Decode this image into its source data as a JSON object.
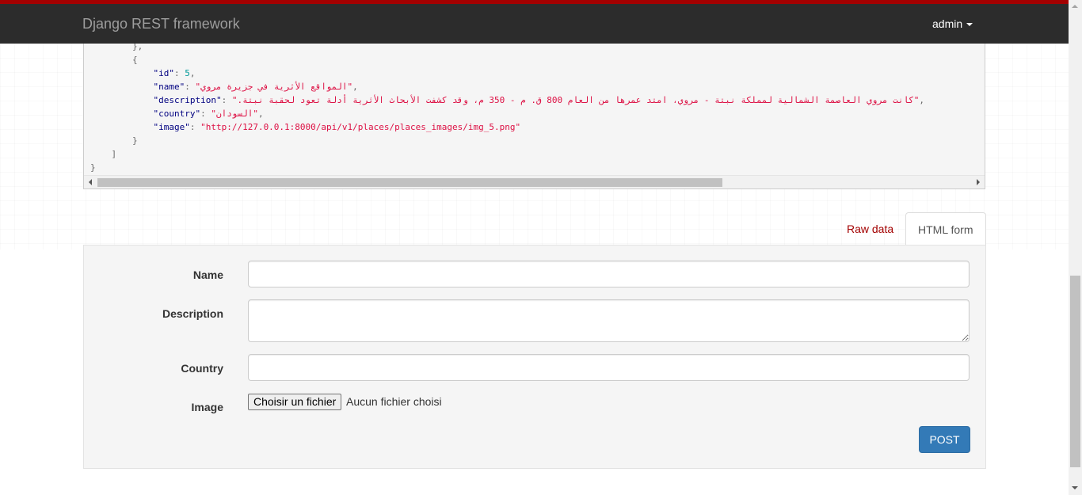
{
  "navbar": {
    "brand": "Django REST framework",
    "user": "admin",
    "accent_color": "#a30000",
    "background_color": "#2c2c2c"
  },
  "response": {
    "lines": [
      [
        {
          "t": "p",
          "v": "        },"
        }
      ],
      [
        {
          "t": "p",
          "v": "        {"
        }
      ],
      [
        {
          "t": "p",
          "v": "            "
        },
        {
          "t": "k",
          "v": "\"id\""
        },
        {
          "t": "p",
          "v": ": "
        },
        {
          "t": "n",
          "v": "5"
        },
        {
          "t": "p",
          "v": ","
        }
      ],
      [
        {
          "t": "p",
          "v": "            "
        },
        {
          "t": "k",
          "v": "\"name\""
        },
        {
          "t": "p",
          "v": ": "
        },
        {
          "t": "s",
          "v": "\"المواقع الأثرية في جزيرة مروي\""
        },
        {
          "t": "p",
          "v": ","
        }
      ],
      [
        {
          "t": "p",
          "v": "            "
        },
        {
          "t": "k",
          "v": "\"description\""
        },
        {
          "t": "p",
          "v": ": "
        },
        {
          "t": "s",
          "v": "\"كانت مروي العاصمة الشمالية لمملكة نبتة - مروي، امتد عمرها من العام 800 ق. م - 350 م، وقد كشفت الأبحاث الأثرية أدلة تعود لحقبة نبتة.\""
        },
        {
          "t": "p",
          "v": ","
        }
      ],
      [
        {
          "t": "p",
          "v": "            "
        },
        {
          "t": "k",
          "v": "\"country\""
        },
        {
          "t": "p",
          "v": ": "
        },
        {
          "t": "s",
          "v": "\"السودان\""
        },
        {
          "t": "p",
          "v": ","
        }
      ],
      [
        {
          "t": "p",
          "v": "            "
        },
        {
          "t": "k",
          "v": "\"image\""
        },
        {
          "t": "p",
          "v": ": "
        },
        {
          "t": "s",
          "v": "\"http://127.0.0.1:8000/api/v1/places/places_images/img_5.png\""
        }
      ],
      [
        {
          "t": "p",
          "v": "        }"
        }
      ],
      [
        {
          "t": "p",
          "v": "    ]"
        }
      ],
      [
        {
          "t": "p",
          "v": "}"
        }
      ]
    ]
  },
  "tabs": {
    "raw": "Raw data",
    "html": "HTML form"
  },
  "form": {
    "name_label": "Name",
    "description_label": "Description",
    "country_label": "Country",
    "image_label": "Image",
    "name_value": "",
    "description_value": "",
    "country_value": "",
    "file_button": "Choisir un fichier",
    "file_status": "Aucun fichier choisi",
    "submit": "POST"
  }
}
